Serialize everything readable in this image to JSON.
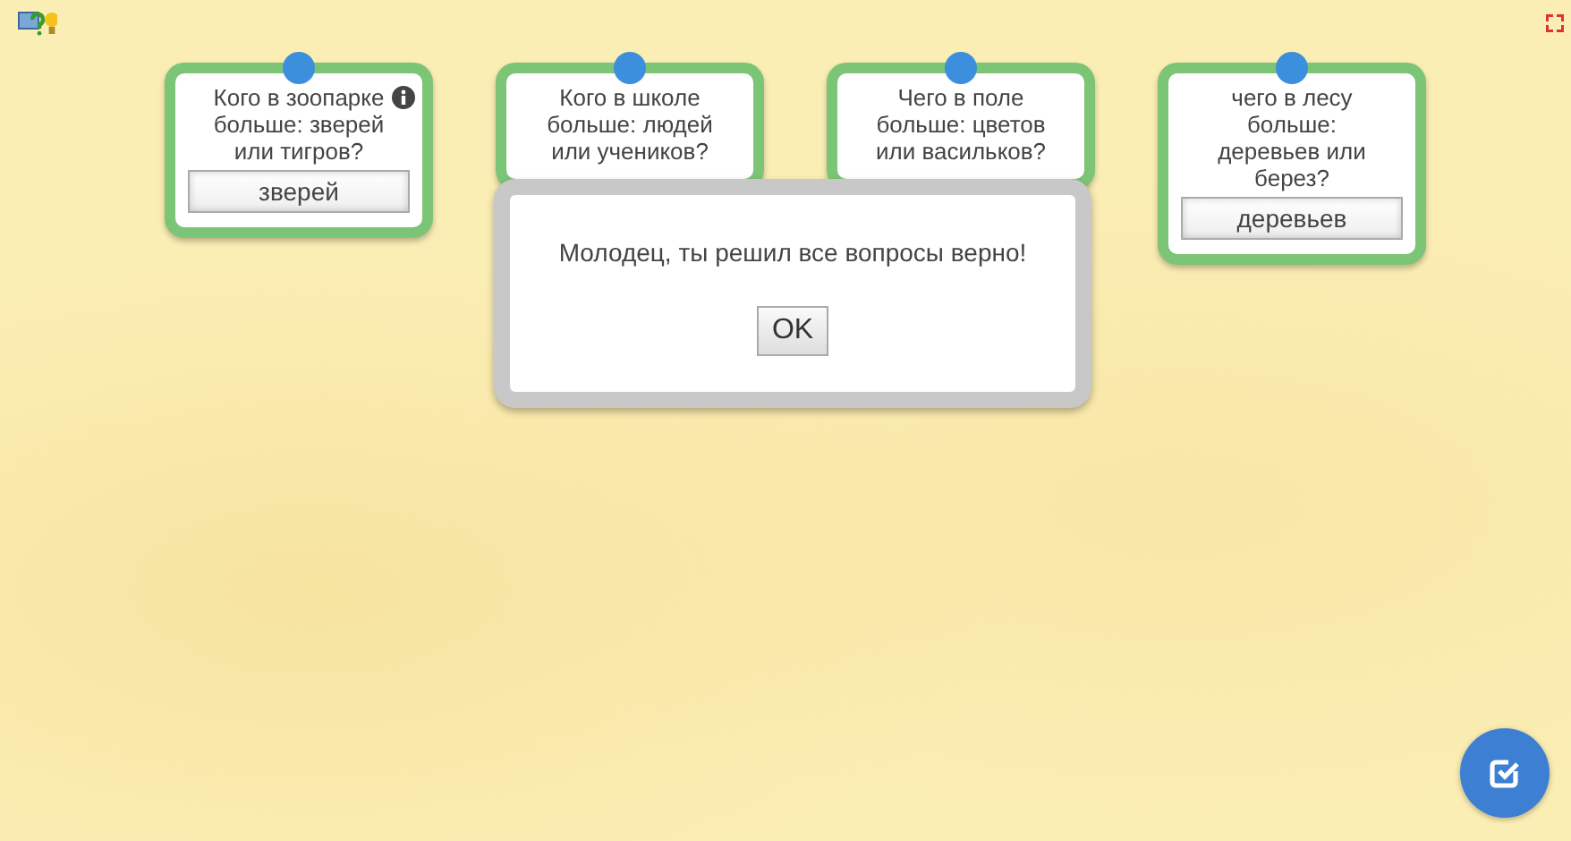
{
  "cards": [
    {
      "question": "Кого в зоопарке больше: зверей или тигров?",
      "info": true,
      "answer": "зверей"
    },
    {
      "question": "Кого в школе больше: людей или учеников?",
      "info": false
    },
    {
      "question": "Чего в поле больше: цветов или васильков?",
      "info": false
    },
    {
      "question": "чего в лесу больше: деревьев или берез?",
      "info": false,
      "answer": "деревьев"
    }
  ],
  "dialog": {
    "message": "Молодец, ты решил все вопросы верно!",
    "button": "OK"
  }
}
